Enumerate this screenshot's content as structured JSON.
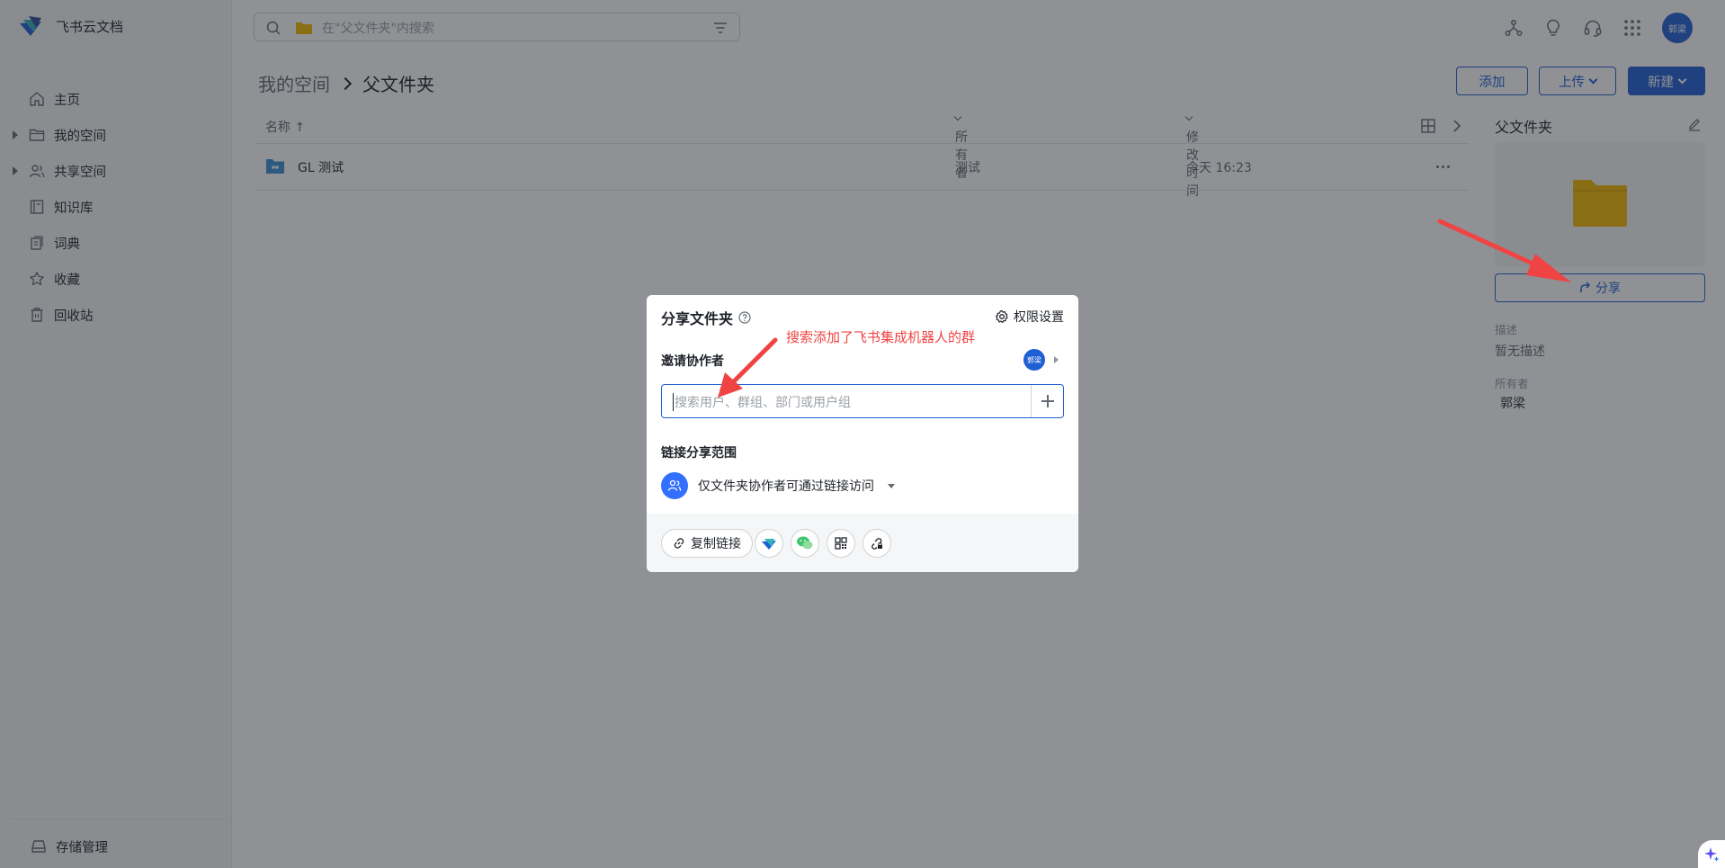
{
  "app": {
    "name": "飞书云文档"
  },
  "sidebar": {
    "items": [
      {
        "label": "主页",
        "icon": "home-icon",
        "expandable": false
      },
      {
        "label": "我的空间",
        "icon": "folder-icon",
        "expandable": true
      },
      {
        "label": "共享空间",
        "icon": "users-icon",
        "expandable": true
      },
      {
        "label": "知识库",
        "icon": "book-icon",
        "expandable": false
      },
      {
        "label": "词典",
        "icon": "dictionary-icon",
        "expandable": false
      },
      {
        "label": "收藏",
        "icon": "star-icon",
        "expandable": false
      },
      {
        "label": "回收站",
        "icon": "trash-icon",
        "expandable": false
      }
    ],
    "storage": {
      "label": "存储管理",
      "icon": "storage-icon"
    }
  },
  "search": {
    "placeholder": "在\"父文件夹\"内搜索"
  },
  "user": {
    "avatar_text": "郭梁"
  },
  "breadcrumb": {
    "parent": "我的空间",
    "current": "父文件夹"
  },
  "toolbar": {
    "add_label": "添加",
    "upload_label": "上传",
    "new_label": "新建"
  },
  "table": {
    "headers": {
      "name": "名称 ↑",
      "owner": "所有者",
      "modified": "修改时间"
    },
    "rows": [
      {
        "name": "GL 测试",
        "owner": "测试",
        "modified": "今天 16:23"
      }
    ]
  },
  "details": {
    "title": "父文件夹",
    "share_label": "分享",
    "description_label": "描述",
    "description_value": "暂无描述",
    "owner_label": "所有者",
    "owner_value": "郭梁"
  },
  "dialog": {
    "title": "分享文件夹",
    "permission_settings": "权限设置",
    "invite_label": "邀请协作者",
    "collaborator_avatar": "郭梁",
    "invite_placeholder": "搜索用户、群组、部门或用户组",
    "link_scope_label": "链接分享范围",
    "link_scope_value": "仅文件夹协作者可通过链接访问",
    "copy_link_label": "复制链接"
  },
  "annotation": {
    "text": "搜索添加了飞书集成机器人的群",
    "color": "#f04444"
  },
  "colors": {
    "accent": "#1f5fd4",
    "sidebar_bg": "#f5f6f7",
    "overlay": "rgba(31,35,41,0.5)"
  }
}
